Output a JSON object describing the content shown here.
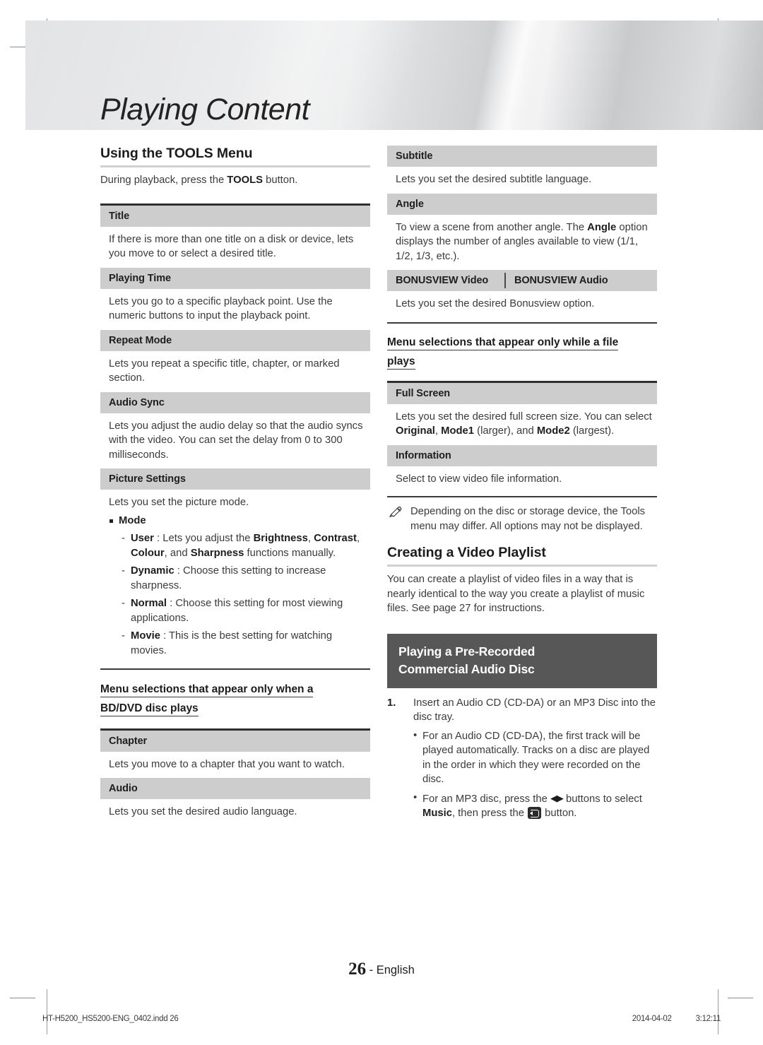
{
  "header": {
    "title": "Playing Content"
  },
  "left": {
    "h2": "Using the TOOLS Menu",
    "intro_a": "During playback, press the ",
    "intro_b": "TOOLS",
    "intro_c": " button.",
    "rows": [
      {
        "head": "Title",
        "body": "If there is more than one title on a disk or device, lets you move to or select a desired title."
      },
      {
        "head": "Playing Time",
        "body": "Lets you go to a specific playback point. Use the numeric buttons to input the playback point."
      },
      {
        "head": "Repeat Mode",
        "body": "Lets you repeat a specific title, chapter, or marked section."
      },
      {
        "head": "Audio Sync",
        "body": "Lets you adjust the audio delay so that the audio syncs with the video. You can set the delay from 0 to 300 milliseconds."
      },
      {
        "head": "Picture Settings",
        "body": "Lets you set the picture mode."
      }
    ],
    "mode_label": "Mode",
    "modes": [
      {
        "name": "User",
        "sep": " : ",
        "t1": "Lets you adjust the ",
        "b1": "Brightness",
        "t2": ", ",
        "b2": "Contrast",
        "t3": ", ",
        "b3": "Colour",
        "t4": ", and ",
        "b4": "Sharpness",
        "t5": " functions manually."
      },
      {
        "name": "Dynamic",
        "sep": " : ",
        "t1": "Choose this setting to increase sharpness."
      },
      {
        "name": "Normal",
        "sep": " : ",
        "t1": "Choose this setting for most viewing applications."
      },
      {
        "name": "Movie",
        "sep": " : ",
        "t1": "This is the best setting for watching movies."
      }
    ],
    "h3_line1": "Menu selections that appear only when a",
    "h3_line2": "BD/DVD disc plays",
    "rows2": [
      {
        "head": "Chapter",
        "body": "Lets you move to a chapter that you want to watch."
      },
      {
        "head": "Audio",
        "body": "Lets you set the desired audio language."
      }
    ]
  },
  "right": {
    "rows1": [
      {
        "head": "Subtitle",
        "body": "Lets you set the desired subtitle language."
      }
    ],
    "angle_head": "Angle",
    "angle_t1": "To view a scene from another angle. The ",
    "angle_b1": "Angle",
    "angle_t2": " option displays the number of angles available to view (1/1, 1/2, 1/3, etc.).",
    "bonus_video": "BONUSVIEW Video",
    "bonus_audio": "BONUSVIEW Audio",
    "bonus_body": "Lets you set the desired Bonusview option.",
    "h3_line1": "Menu selections that appear only while a file",
    "h3_line2": "plays",
    "full_screen_head": "Full Screen",
    "fs_t1": "Lets you set the desired full screen size. You can select ",
    "fs_b1": "Original",
    "fs_t2": ", ",
    "fs_b2": "Mode1",
    "fs_t3": " (larger), and ",
    "fs_b3": "Mode2",
    "fs_t4": " (largest).",
    "information_head": "Information",
    "information_body": "Select to view video file information.",
    "note": "Depending on the disc or storage device, the Tools menu may differ. All options may not be displayed.",
    "playlist_h2": "Creating a Video Playlist",
    "playlist_body": "You can create a playlist of video files in a way that is nearly identical to the way you create a playlist of music files. See page 27 for instructions.",
    "dark_line1": "Playing a Pre-Recorded",
    "dark_line2": "Commercial Audio Disc",
    "step1_num": "1.",
    "step1_text": "Insert an Audio CD (CD-DA) or an MP3 Disc into the disc tray.",
    "bullet1": "For an Audio CD (CD-DA), the first track will be played automatically. Tracks on a disc are played in the order in which they were recorded on the disc.",
    "bullet2_t1": "For an MP3 disc, press the ",
    "bullet2_arrows": "◀▶",
    "bullet2_t2": " buttons to select ",
    "bullet2_b1": "Music",
    "bullet2_t3": ", then press the ",
    "bullet2_t4": " button."
  },
  "page_number": {
    "number": "26",
    "lang": "- English"
  },
  "footer": {
    "file": "HT-H5200_HS5200-ENG_0402.indd   26",
    "date": "2014-04-02",
    "time": "3:12:11"
  },
  "colors": {
    "row_head_bg": "#cdcdcd",
    "dark_banner_bg": "#575757",
    "rule_dark": "#2f2f2f",
    "rule_light": "#d0d0d0"
  }
}
